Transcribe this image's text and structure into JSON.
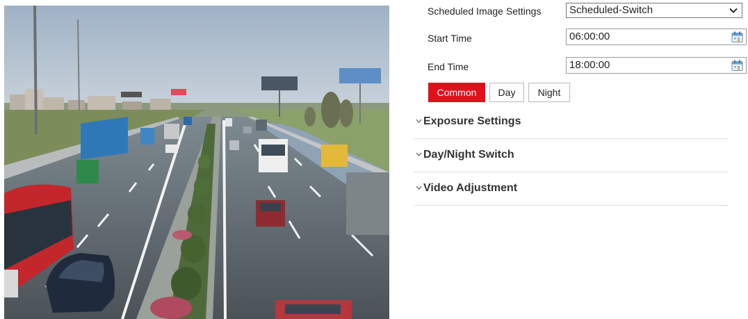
{
  "settings": {
    "schedule_label": "Scheduled Image Settings",
    "schedule_value": "Scheduled-Switch",
    "start_label": "Start Time",
    "start_value": "06:00:00",
    "end_label": "End Time",
    "end_value": "18:00:00"
  },
  "tabs": [
    {
      "label": "Common",
      "active": true
    },
    {
      "label": "Day",
      "active": false
    },
    {
      "label": "Night",
      "active": false
    }
  ],
  "sections": [
    {
      "title": "Exposure Settings",
      "icon": "chevron-down-icon"
    },
    {
      "title": "Day/Night Switch",
      "icon": "chevron-down-icon"
    },
    {
      "title": "Video Adjustment",
      "icon": "chevron-down-icon"
    }
  ],
  "colors": {
    "accent": "#e0101c"
  }
}
